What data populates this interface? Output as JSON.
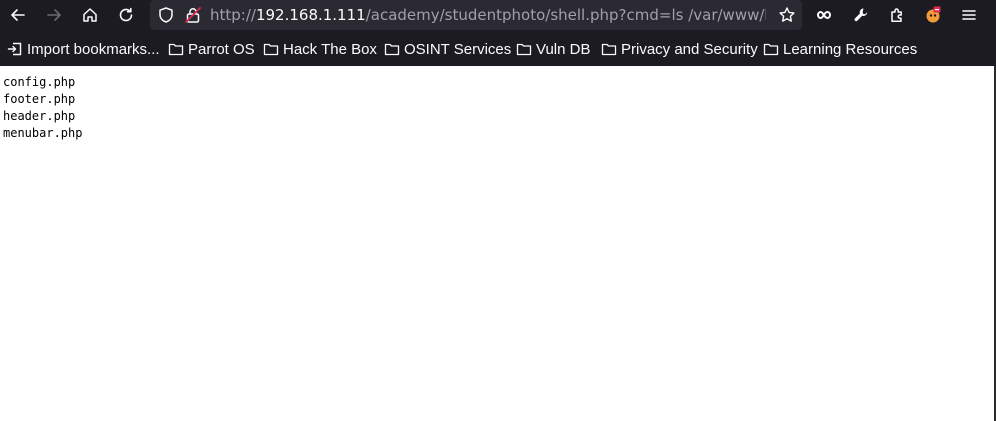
{
  "browser": {
    "url": {
      "scheme": "http://",
      "host": "192.168.1.111",
      "path": "/academy/studentphoto/shell.php?cmd=ls /var/www/html/ac"
    }
  },
  "bookmarks": {
    "items": [
      {
        "label": "Import bookmarks..."
      },
      {
        "label": "Parrot OS"
      },
      {
        "label": "Hack The Box"
      },
      {
        "label": "OSINT Services"
      },
      {
        "label": "Vuln DB"
      },
      {
        "label": "Privacy and Security"
      },
      {
        "label": "Learning Resources"
      }
    ]
  },
  "page": {
    "files": [
      "config.php",
      "footer.php",
      "header.php",
      "menubar.php"
    ]
  },
  "colors": {
    "chrome_bg": "#1c1b22",
    "urlbar_bg": "#2b2a33",
    "text_light": "#fbfbfe",
    "text_dim": "#a0a0aa",
    "content_bg": "#ffffff"
  }
}
